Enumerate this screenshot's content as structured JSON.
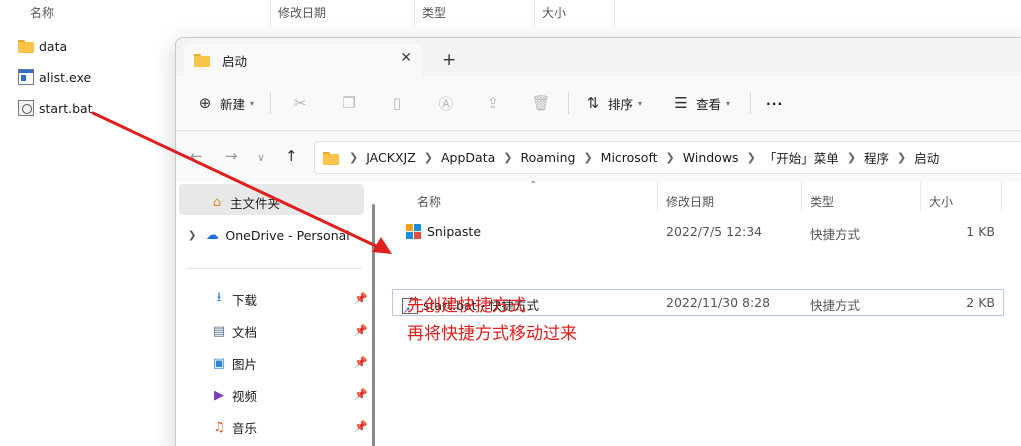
{
  "background_window": {
    "columns": {
      "name": "名称",
      "modified": "修改日期",
      "type": "类型",
      "size": "大小"
    },
    "files": [
      {
        "name": "data",
        "icon": "folder-icon"
      },
      {
        "name": "alist.exe",
        "icon": "exe-icon"
      },
      {
        "name": "start.bat",
        "icon": "bat-icon"
      }
    ]
  },
  "window": {
    "tab_title": "启动",
    "toolbar": {
      "new_label": "新建",
      "sort_label": "排序",
      "view_label": "查看",
      "more_label": "···"
    },
    "breadcrumbs": [
      "JACKXJZ",
      "AppData",
      "Roaming",
      "Microsoft",
      "Windows",
      "「开始」菜单",
      "程序",
      "启动"
    ],
    "sidebar": {
      "items": [
        {
          "label": "主文件夹",
          "icon": "home-icon"
        },
        {
          "label": "OneDrive - Personal",
          "icon": "cloud-icon"
        },
        {
          "label": "下载",
          "icon": "download-icon"
        },
        {
          "label": "文档",
          "icon": "document-icon"
        },
        {
          "label": "图片",
          "icon": "image-icon"
        },
        {
          "label": "视频",
          "icon": "video-icon"
        },
        {
          "label": "音乐",
          "icon": "music-icon"
        }
      ]
    },
    "columns": {
      "name": "名称",
      "modified": "修改日期",
      "type": "类型",
      "size": "大小"
    },
    "files": [
      {
        "name": "Snipaste",
        "modified": "2022/7/5 12:34",
        "type": "快捷方式",
        "size": "1 KB"
      },
      {
        "name": "start.bat - 快捷方式",
        "modified": "2022/11/30 8:28",
        "type": "快捷方式",
        "size": "2 KB"
      }
    ]
  },
  "annotation": {
    "line1": "先创建快捷方式",
    "line2": "再将快捷方式移动过来",
    "color": "#e0201e"
  }
}
